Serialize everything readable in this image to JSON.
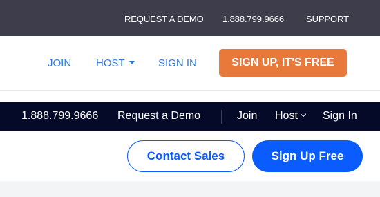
{
  "utility_bar": {
    "demo": "REQUEST A DEMO",
    "phone": "1.888.799.9666",
    "support": "SUPPORT"
  },
  "old_nav": {
    "join": "JOIN",
    "host": "HOST",
    "signin": "SIGN IN",
    "signup": "SIGN UP, IT'S FREE"
  },
  "new_bar": {
    "phone": "1.888.799.9666",
    "demo": "Request a Demo",
    "join": "Join",
    "host": "Host",
    "signin": "Sign In"
  },
  "cta": {
    "contact_sales": "Contact Sales",
    "sign_up": "Sign Up Free"
  },
  "colors": {
    "utility_bg": "#3e3d4c",
    "old_link": "#2d7be0",
    "old_signup": "#e8793a",
    "new_bar_bg": "#050a29",
    "primary_blue": "#0b5cff"
  },
  "icons": {
    "host_caret": "caret-down-icon",
    "host_chevron": "chevron-down-icon"
  }
}
